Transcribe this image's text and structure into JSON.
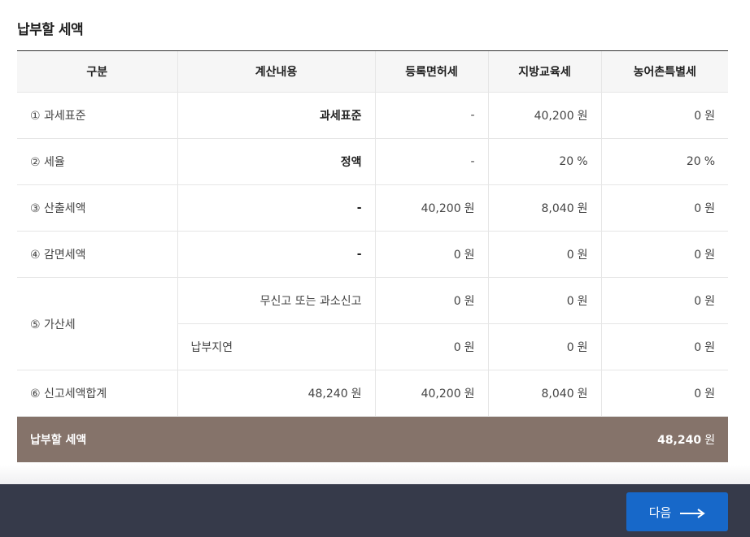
{
  "section": {
    "title": "납부할 세액"
  },
  "table": {
    "headers": [
      "구분",
      "계산내용",
      "등록면허세",
      "지방교육세",
      "농어촌특별세"
    ],
    "rows": [
      {
        "label": "① 과세표준",
        "calc": "과세표준",
        "reg_tax": "-",
        "edu_tax": {
          "value": "40,200",
          "unit": "원"
        },
        "rural_tax": {
          "value": "0",
          "unit": "원"
        }
      },
      {
        "label": "② 세율",
        "calc": "정액",
        "reg_tax": "-",
        "edu_tax": {
          "value": "20",
          "unit": "%"
        },
        "rural_tax": {
          "value": "20",
          "unit": "%"
        }
      },
      {
        "label": "③ 산출세액",
        "calc": "-",
        "reg_tax": {
          "value": "40,200",
          "unit": "원"
        },
        "edu_tax": {
          "value": "8,040",
          "unit": "원"
        },
        "rural_tax": {
          "value": "0",
          "unit": "원"
        }
      },
      {
        "label": "④ 감면세액",
        "calc": "-",
        "reg_tax": {
          "value": "0",
          "unit": "원"
        },
        "edu_tax": {
          "value": "0",
          "unit": "원"
        },
        "rural_tax": {
          "value": "0",
          "unit": "원"
        }
      },
      {
        "label": "⑤ 가산세",
        "sub": [
          {
            "calc": "무신고 또는 과소신고",
            "reg_tax": {
              "value": "0",
              "unit": "원"
            },
            "edu_tax": {
              "value": "0",
              "unit": "원"
            },
            "rural_tax": {
              "value": "0",
              "unit": "원"
            }
          },
          {
            "calc": "납부지연",
            "reg_tax": {
              "value": "0",
              "unit": "원"
            },
            "edu_tax": {
              "value": "0",
              "unit": "원"
            },
            "rural_tax": {
              "value": "0",
              "unit": "원"
            }
          }
        ]
      },
      {
        "label": "⑥ 신고세액합계",
        "calc": {
          "value": "48,240",
          "unit": "원"
        },
        "reg_tax": {
          "value": "40,200",
          "unit": "원"
        },
        "edu_tax": {
          "value": "8,040",
          "unit": "원"
        },
        "rural_tax": {
          "value": "0",
          "unit": "원"
        }
      }
    ],
    "total": {
      "label": "납부할 세액",
      "value": "48,240",
      "unit": "원"
    }
  },
  "footer": {
    "next_label": "다음"
  },
  "colors": {
    "total_row_bg": "#85736a",
    "footer_bg": "#363a4a",
    "next_button_bg": "#1768c9"
  },
  "icons": {
    "next_arrow": "long-right-arrow-icon"
  }
}
